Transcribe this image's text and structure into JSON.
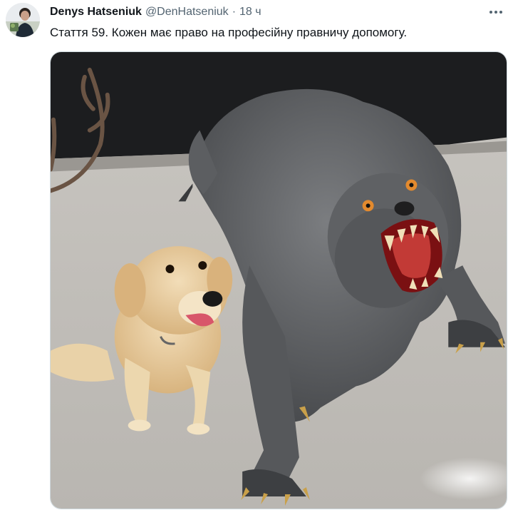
{
  "author": {
    "display_name": "Denys Hatseniuk",
    "handle": "@DenHatseniuk",
    "separator": "·",
    "time": "18 ч",
    "avatar": "avatar-photo"
  },
  "tweet": {
    "text": "Стаття 59. Кожен має право на професійну правничу допомогу."
  },
  "media": {
    "kind": "photo",
    "depicts": [
      "golden retriever",
      "werewolf figure",
      "antlers"
    ]
  },
  "icons": {
    "more": "more-horizontal-icon"
  },
  "colors": {
    "text_primary": "#0f1419",
    "text_secondary": "#536471",
    "border": "#cfd9de"
  }
}
